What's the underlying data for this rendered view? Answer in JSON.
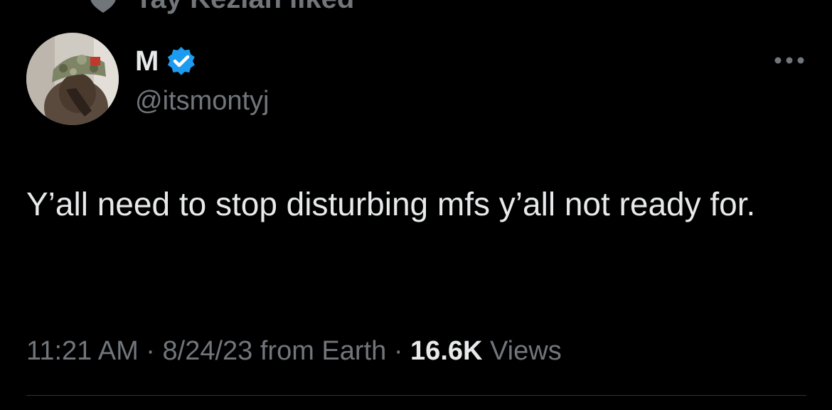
{
  "social_context": {
    "text": "Tay Kezian liked",
    "icon": "heart-icon"
  },
  "tweet": {
    "author": {
      "display_name": "M",
      "handle": "@itsmontyj",
      "verified_icon": "verified-badge-icon",
      "avatar_icon": "avatar"
    },
    "more_icon": "more-options-icon",
    "text": "Y’all need to stop disturbing mfs y’all not ready for.",
    "meta": {
      "time": "11:21 AM",
      "date": "8/24/23",
      "source": "from Earth",
      "views_count": "16.6K",
      "views_label": "Views",
      "separator": "·"
    }
  },
  "colors": {
    "background": "#000000",
    "primary_text": "#e7e9ea",
    "secondary_text": "#71767b",
    "verified_blue": "#1d9bf0",
    "divider": "#2f3336"
  }
}
